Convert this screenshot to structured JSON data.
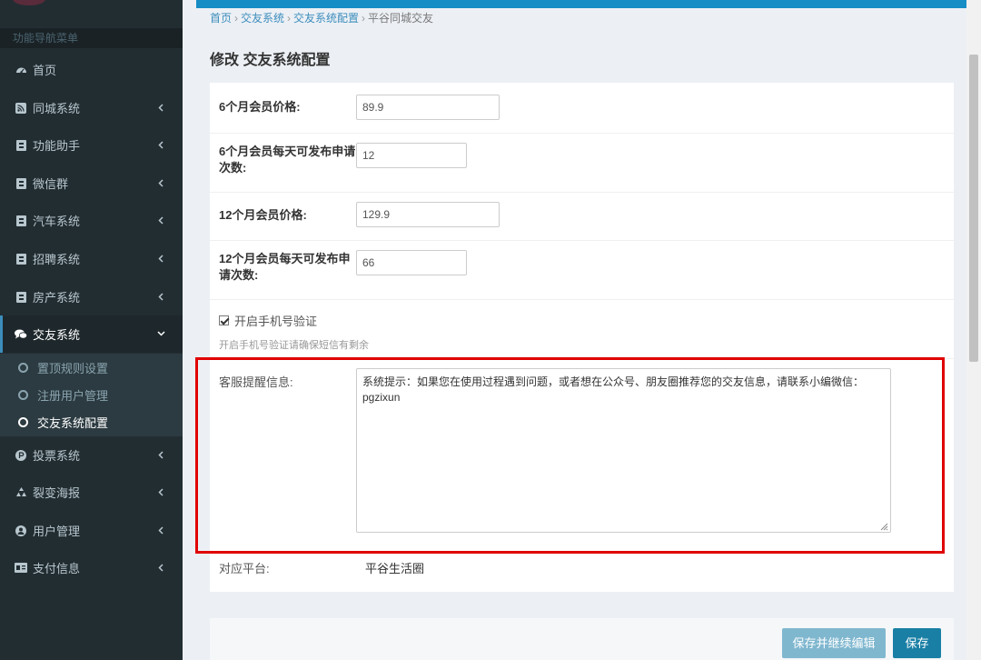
{
  "sidebar": {
    "header": "功能导航菜单",
    "items": [
      {
        "label": "首页",
        "icon": "dashboard-icon",
        "expandable": false
      },
      {
        "label": "同城系统",
        "icon": "rss-icon",
        "expandable": true
      },
      {
        "label": "功能助手",
        "icon": "book-icon",
        "expandable": true
      },
      {
        "label": "微信群",
        "icon": "book-icon",
        "expandable": true
      },
      {
        "label": "汽车系统",
        "icon": "book-icon",
        "expandable": true
      },
      {
        "label": "招聘系统",
        "icon": "book-icon",
        "expandable": true
      },
      {
        "label": "房产系统",
        "icon": "book-icon",
        "expandable": true
      },
      {
        "label": "交友系统",
        "icon": "comments-icon",
        "expandable": true,
        "open": true
      },
      {
        "label": "投票系统",
        "icon": "product-hunt-icon",
        "expandable": true
      },
      {
        "label": "裂变海报",
        "icon": "recycle-icon",
        "expandable": true
      },
      {
        "label": "用户管理",
        "icon": "user-circle-icon",
        "expandable": true
      },
      {
        "label": "支付信息",
        "icon": "id-card-icon",
        "expandable": true
      }
    ],
    "sub_items": [
      {
        "label": "置顶规则设置"
      },
      {
        "label": "注册用户管理"
      },
      {
        "label": "交友系统配置",
        "active": true
      }
    ]
  },
  "breadcrumb": {
    "home": "首页",
    "level1": "交友系统",
    "level2": "交友系统配置",
    "current": "平谷同城交友",
    "separator": "›"
  },
  "page_title": "修改 交友系统配置",
  "form": {
    "price_6m": {
      "label": "6个月会员价格:",
      "value": "89.9"
    },
    "apply_6m": {
      "label_line1": "6个月会员每天可发布申请",
      "label_line2": "次数:",
      "value": "12"
    },
    "price_12m": {
      "label": "12个月会员价格:",
      "value": "129.9"
    },
    "apply_12m": {
      "label_line1": "12个月会员每天可发布申",
      "label_line2": "请次数:",
      "value": "66"
    },
    "phone_verify": {
      "label": "开启手机号验证",
      "checked": true,
      "help": "开启手机号验证请确保短信有剩余"
    },
    "cs_reminder": {
      "label": "客服提醒信息:",
      "value_line1": "系统提示：如果您在使用过程遇到问题，或者想在公众号、朋友圈推荐您的交友信息，请联系小编微信：",
      "value_line2": "pgzixun"
    },
    "platform": {
      "label": "对应平台:",
      "value": "平谷生活圈"
    }
  },
  "buttons": {
    "save_continue": "保存并继续编辑",
    "save": "保存"
  },
  "colors": {
    "sidebar_bg": "#222d32",
    "accent": "#3c8dbc",
    "topbar": "#168dc4",
    "highlight_box": "#e00000",
    "save_button": "#1a7fa5"
  }
}
